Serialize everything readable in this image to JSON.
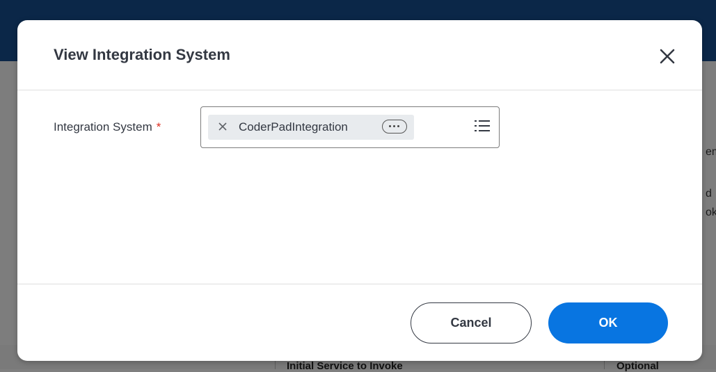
{
  "background": {
    "right_edge_fragments": [
      "em",
      "d",
      "ok"
    ],
    "table_row": {
      "col1": "Initial Service to Invoke",
      "col2": "Optional"
    }
  },
  "modal": {
    "title": "View Integration System",
    "close_icon": "close-icon",
    "field": {
      "label": "Integration System",
      "required_marker": "*",
      "selected_value": "CoderPadIntegration",
      "remove_icon": "x-icon",
      "more_icon": "ellipsis-icon",
      "prompt_icon": "list-icon"
    },
    "buttons": {
      "cancel": "Cancel",
      "ok": "OK"
    }
  },
  "colors": {
    "primary": "#0875e1",
    "required": "#de2e21",
    "header_bg": "#0b2748"
  }
}
